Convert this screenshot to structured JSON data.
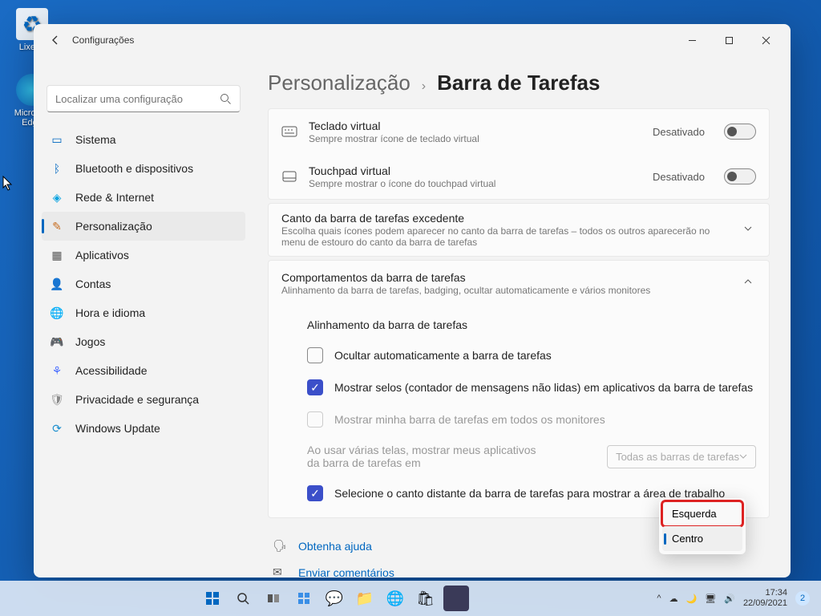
{
  "desktop": {
    "recycle_label": "Lixeira",
    "edge_label": "Microsoft Edge"
  },
  "window": {
    "title": "Configurações",
    "breadcrumb": {
      "seg1": "Personalização",
      "chev": "›",
      "seg2": "Barra de Tarefas"
    },
    "search_placeholder": "Localizar uma configuração"
  },
  "nav": [
    {
      "label": "Sistema",
      "color": "#0067c0",
      "glyph": "▭"
    },
    {
      "label": "Bluetooth e dispositivos",
      "color": "#0067c0",
      "glyph": "ᛒ"
    },
    {
      "label": "Rede & Internet",
      "color": "#0aa3e0",
      "glyph": "◈"
    },
    {
      "label": "Personalização",
      "color": "#c76b1d",
      "glyph": "✎",
      "active": true
    },
    {
      "label": "Aplicativos",
      "color": "#555",
      "glyph": "▦"
    },
    {
      "label": "Contas",
      "color": "#2aa86b",
      "glyph": "👤"
    },
    {
      "label": "Hora e idioma",
      "color": "#1c8fcf",
      "glyph": "🌐"
    },
    {
      "label": "Jogos",
      "color": "#666",
      "glyph": "🎮"
    },
    {
      "label": "Acessibilidade",
      "color": "#4b6fff",
      "glyph": "⚘"
    },
    {
      "label": "Privacidade e segurança",
      "color": "#888",
      "glyph": "🛡"
    },
    {
      "label": "Windows Update",
      "color": "#1c8fcf",
      "glyph": "⟳"
    }
  ],
  "rows": {
    "row1": {
      "title": "Teclado virtual",
      "sub": "Sempre mostrar ícone de teclado virtual",
      "status": "Desativado"
    },
    "row2": {
      "title": "Touchpad virtual",
      "sub": "Sempre mostrar o ícone do touchpad virtual",
      "status": "Desativado"
    },
    "overflow": {
      "title": "Canto da barra de tarefas excedente",
      "sub": "Escolha quais ícones podem aparecer no canto da barra de tarefas – todos os outros aparecerão no menu de estouro do canto da barra de tarefas"
    },
    "behaviors": {
      "title": "Comportamentos da barra de tarefas",
      "sub": "Alinhamento da barra de tarefas, badging, ocultar automaticamente e vários monitores"
    }
  },
  "opts": {
    "align": "Alinhamento da barra de tarefas",
    "hide": "Ocultar automaticamente a barra de tarefas",
    "badges": "Mostrar selos (contador de mensagens não lidas) em aplicativos da barra de tarefas",
    "allmon": "Mostrar minha barra de tarefas em todos os monitores",
    "multi_label": "Ao usar várias telas, mostrar meus aplicativos da barra de tarefas em",
    "multi_value": "Todas as barras de tarefas",
    "corner": "Selecione o canto distante da barra de tarefas para mostrar a área de trabalho"
  },
  "dropdown": {
    "opt1": "Esquerda",
    "opt2": "Centro"
  },
  "links": {
    "help": "Obtenha ajuda",
    "feedback": "Enviar comentários"
  },
  "tray": {
    "time": "17:34",
    "date": "22/09/2021",
    "badge": "2"
  }
}
